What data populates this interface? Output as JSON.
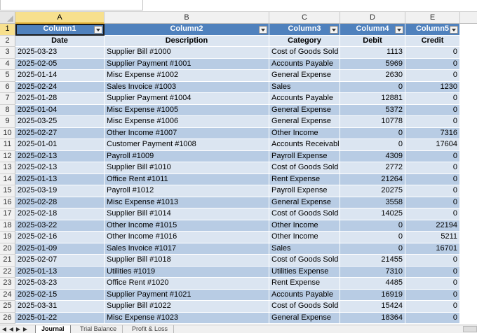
{
  "columns": [
    "A",
    "B",
    "C",
    "D",
    "E"
  ],
  "selected_column": "A",
  "selected_row": 1,
  "table_headers": [
    "Column1",
    "Column2",
    "Column3",
    "Column4",
    "Column5"
  ],
  "field_headers": [
    "Date",
    "Description",
    "Category",
    "Debit",
    "Credit"
  ],
  "rows": [
    [
      "2025-03-23",
      "Supplier Bill #1000",
      "Cost of Goods Sold",
      "1113",
      "0"
    ],
    [
      "2025-02-05",
      "Supplier Payment #1001",
      "Accounts Payable",
      "5969",
      "0"
    ],
    [
      "2025-01-14",
      "Misc Expense #1002",
      "General Expense",
      "2630",
      "0"
    ],
    [
      "2025-02-24",
      "Sales Invoice #1003",
      "Sales",
      "0",
      "1230"
    ],
    [
      "2025-01-28",
      "Supplier Payment #1004",
      "Accounts Payable",
      "12881",
      "0"
    ],
    [
      "2025-01-04",
      "Misc Expense #1005",
      "General Expense",
      "5372",
      "0"
    ],
    [
      "2025-03-25",
      "Misc Expense #1006",
      "General Expense",
      "10778",
      "0"
    ],
    [
      "2025-02-27",
      "Other Income #1007",
      "Other Income",
      "0",
      "7316"
    ],
    [
      "2025-01-01",
      "Customer Payment #1008",
      "Accounts Receivabl",
      "0",
      "17604"
    ],
    [
      "2025-02-13",
      "Payroll #1009",
      "Payroll Expense",
      "4309",
      "0"
    ],
    [
      "2025-02-13",
      "Supplier Bill #1010",
      "Cost of Goods Sold",
      "2772",
      "0"
    ],
    [
      "2025-01-13",
      "Office Rent #1011",
      "Rent Expense",
      "21264",
      "0"
    ],
    [
      "2025-03-19",
      "Payroll #1012",
      "Payroll Expense",
      "20275",
      "0"
    ],
    [
      "2025-02-28",
      "Misc Expense #1013",
      "General Expense",
      "3558",
      "0"
    ],
    [
      "2025-02-18",
      "Supplier Bill #1014",
      "Cost of Goods Sold",
      "14025",
      "0"
    ],
    [
      "2025-03-22",
      "Other Income #1015",
      "Other Income",
      "0",
      "22194"
    ],
    [
      "2025-02-16",
      "Other Income #1016",
      "Other Income",
      "0",
      "5211"
    ],
    [
      "2025-01-09",
      "Sales Invoice #1017",
      "Sales",
      "0",
      "16701"
    ],
    [
      "2025-02-07",
      "Supplier Bill #1018",
      "Cost of Goods Sold",
      "21455",
      "0"
    ],
    [
      "2025-01-13",
      "Utilities #1019",
      "Utilities Expense",
      "7310",
      "0"
    ],
    [
      "2025-03-23",
      "Office Rent #1020",
      "Rent Expense",
      "4485",
      "0"
    ],
    [
      "2025-02-15",
      "Supplier Payment #1021",
      "Accounts Payable",
      "16919",
      "0"
    ],
    [
      "2025-03-31",
      "Supplier Bill #1022",
      "Cost of Goods Sold",
      "15424",
      "0"
    ],
    [
      "2025-01-22",
      "Misc Expense #1023",
      "General Expense",
      "18364",
      "0"
    ]
  ],
  "sheet_tabs": [
    "Journal",
    "Trial Balance",
    "Profit & Loss"
  ],
  "active_tab": "Journal",
  "colors": {
    "table_header": "#4f81bd",
    "field_header": "#dbe5f1",
    "band_light": "#dbe5f1",
    "band_dark": "#b8cce4",
    "selection_header": "#f7e08e"
  }
}
